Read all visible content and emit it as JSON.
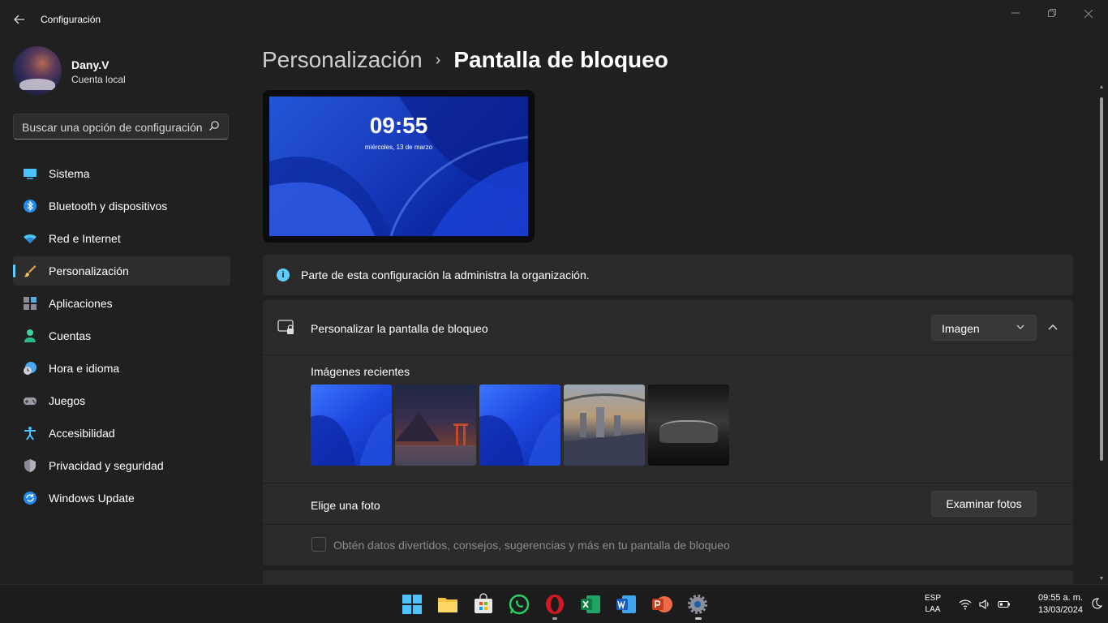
{
  "window": {
    "title": "Configuración",
    "back_icon": "back-arrow-icon",
    "controls": [
      "minimize-icon",
      "restore-icon",
      "close-icon"
    ]
  },
  "profile": {
    "name": "Dany.V",
    "account_type": "Cuenta local"
  },
  "search": {
    "placeholder": "Buscar una opción de configuración"
  },
  "sidebar": {
    "items": [
      {
        "label": "Sistema",
        "icon": "monitor-icon",
        "active": false
      },
      {
        "label": "Bluetooth y dispositivos",
        "icon": "bluetooth-icon",
        "active": false
      },
      {
        "label": "Red e Internet",
        "icon": "wifi-icon",
        "active": false
      },
      {
        "label": "Personalización",
        "icon": "brush-icon",
        "active": true
      },
      {
        "label": "Aplicaciones",
        "icon": "apps-icon",
        "active": false
      },
      {
        "label": "Cuentas",
        "icon": "person-icon",
        "active": false
      },
      {
        "label": "Hora e idioma",
        "icon": "clock-globe-icon",
        "active": false
      },
      {
        "label": "Juegos",
        "icon": "gamepad-icon",
        "active": false
      },
      {
        "label": "Accesibilidad",
        "icon": "accessibility-icon",
        "active": false
      },
      {
        "label": "Privacidad y seguridad",
        "icon": "shield-icon",
        "active": false
      },
      {
        "label": "Windows Update",
        "icon": "update-icon",
        "active": false
      }
    ]
  },
  "breadcrumb": {
    "parent": "Personalización",
    "separator": "›",
    "current": "Pantalla de bloqueo"
  },
  "preview": {
    "time": "09:55",
    "date": "miércoles, 13 de marzo"
  },
  "info": {
    "text": "Parte de esta configuración la administra la organización."
  },
  "lock_screen": {
    "label": "Personalizar la pantalla de bloqueo",
    "mode_selected": "Imagen",
    "recent_title": "Imágenes recientes",
    "recent_images": [
      "blue-bloom-wallpaper",
      "night-temple-wallpaper",
      "blue-bloom-wallpaper",
      "city-bridge-wallpaper",
      "supra-car-wallpaper"
    ],
    "choose_label": "Elige una foto",
    "browse_button": "Examinar fotos",
    "fun_facts_label": "Obtén datos divertidos, consejos, sugerencias y más en tu pantalla de bloqueo",
    "fun_facts_checked": false
  },
  "taskbar": {
    "apps": [
      "start-icon",
      "file-explorer-icon",
      "store-icon",
      "whatsapp-icon",
      "opera-icon",
      "excel-icon",
      "word-icon",
      "powerpoint-icon",
      "settings-icon"
    ],
    "language_line1": "ESP",
    "language_line2": "LAA",
    "time": "09:55 a. m.",
    "date": "13/03/2024"
  },
  "colors": {
    "accent": "#60cdff",
    "background": "#202020",
    "card": "#2b2b2b"
  }
}
